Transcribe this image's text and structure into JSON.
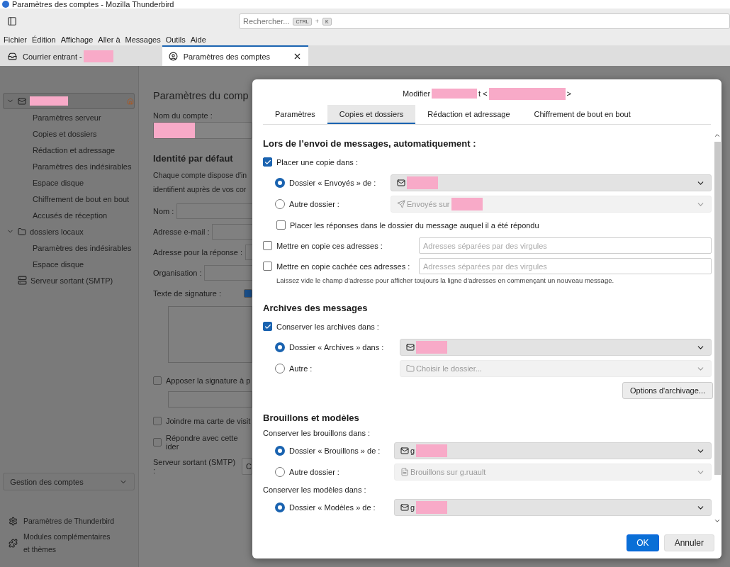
{
  "window": {
    "title": "Paramètres des comptes - Mozilla Thunderbird"
  },
  "toolbar": {
    "search_placeholder": "Rechercher...",
    "shortcut_keys": [
      "CTRL",
      "K"
    ],
    "shortcut_joiner": "+"
  },
  "menu": [
    "Fichier",
    "Édition",
    "Affichage",
    "Aller à",
    "Messages",
    "Outils",
    "Aide"
  ],
  "tabs": [
    {
      "label": "Courrier entrant -",
      "kind": "mail",
      "redacted": true,
      "closable": false,
      "selected": false
    },
    {
      "label": "Paramètres des comptes",
      "kind": "account",
      "redacted": false,
      "closable": true,
      "selected": true
    }
  ],
  "sidebar": {
    "tree": [
      {
        "kind": "account",
        "redacted": true,
        "expanded": true,
        "selected": true,
        "children": [
          {
            "label": "Paramètres serveur",
            "selected": false
          },
          {
            "label": "Copies et dossiers",
            "selected": false
          },
          {
            "label": "Rédaction et adressage",
            "selected": false
          },
          {
            "label": "Paramètres des indésirables",
            "selected": false
          },
          {
            "label": "Espace disque",
            "selected": false
          },
          {
            "label": "Chiffrement de bout en bout",
            "selected": false
          },
          {
            "label": "Accusés de réception",
            "selected": false
          }
        ]
      },
      {
        "kind": "folder",
        "label": "dossiers locaux",
        "redacted": false,
        "expanded": true,
        "selected": false,
        "children": [
          {
            "label": "Paramètres des indésirables",
            "selected": false
          },
          {
            "label": "Espace disque",
            "selected": false
          }
        ]
      },
      {
        "kind": "server",
        "label": "Serveur sortant (SMTP)",
        "redacted": false,
        "selected": false
      }
    ],
    "manage_button": "Gestion des comptes",
    "links": [
      {
        "kind": "settings",
        "label": "Paramètres de Thunderbird"
      },
      {
        "kind": "addons",
        "label": "Modules complémentaires et thèmes"
      }
    ]
  },
  "account_page": {
    "heading": "Paramètres du comp",
    "account_name_label": "Nom du compte :",
    "identity_heading": "Identité par défaut",
    "description": [
      "Chaque compte dispose d'in",
      "identifient auprès de vos cor"
    ],
    "fields": [
      "Nom :",
      "Adresse e-mail :",
      "Adresse pour la réponse :",
      "Organisation :"
    ],
    "signature_label": "Texte de signature :",
    "signature_checkbox": {
      "checked": true
    },
    "checkboxes": [
      {
        "label": "Apposer la signature à p",
        "checked": false
      },
      {
        "label": "Joindre ma carte de visit",
        "checked": false
      },
      {
        "label": "Répondre avec cette ider",
        "checked": false
      }
    ],
    "smtp_label": "Serveur sortant (SMTP) :",
    "smtp_value": "C"
  },
  "dialog": {
    "title": [
      "Modifier",
      "t <",
      ">"
    ],
    "tabs": [
      {
        "label": "Paramètres",
        "selected": false
      },
      {
        "label": "Copies et dossiers",
        "selected": true
      },
      {
        "label": "Rédaction et adressage",
        "selected": false
      },
      {
        "label": "Chiffrement de bout en bout",
        "selected": false
      }
    ],
    "sections": [
      {
        "kind": "sent",
        "heading": "Lors de l’envoi de messages, automatiquement :",
        "checkbox": {
          "label": "Placer une copie dans :",
          "checked": true
        },
        "groups": [
          {
            "options": [
              {
                "label": "Dossier « Envoyés » de :",
                "selected": true,
                "select": {
                  "redacted": true,
                  "disabled": false
                }
              },
              {
                "label": "Autre dossier :",
                "selected": false,
                "select": {
                  "value": "Envoyés sur",
                  "redacted": true,
                  "disabled": true
                }
              }
            ]
          }
        ],
        "extra_checkbox": {
          "label": "Placer les réponses dans le dossier du message auquel il a été répondu",
          "checked": false
        },
        "cc_rows": [
          {
            "label": "Mettre en copie ces adresses :",
            "checked": false,
            "placeholder": "Adresses séparées par des virgules"
          },
          {
            "label": "Mettre en copie cachée ces adresses :",
            "checked": false,
            "placeholder": "Adresses séparées par des virgules"
          }
        ],
        "hint": "Laissez vide le champ d'adresse pour afficher toujours la ligne d'adresses en commençant un nouveau message."
      },
      {
        "kind": "archives",
        "heading": "Archives des messages",
        "checkbox": {
          "label": "Conserver les archives dans :",
          "checked": true
        },
        "groups": [
          {
            "options": [
              {
                "label": "Dossier « Archives » dans :",
                "selected": true,
                "select": {
                  "redacted": true,
                  "disabled": false
                }
              },
              {
                "label": "Autre :",
                "selected": false,
                "select": {
                  "value": "Choisir le dossier...",
                  "redacted": false,
                  "disabled": true
                }
              }
            ]
          }
        ],
        "button": "Options d'archivage..."
      },
      {
        "kind": "drafts",
        "heading": "Brouillons et modèles",
        "groups": [
          {
            "sublabel": "Conserver les brouillons dans :",
            "options": [
              {
                "label": "Dossier « Brouillons » de :",
                "selected": true,
                "select": {
                  "value": "g",
                  "redacted": true,
                  "disabled": false
                }
              },
              {
                "label": "Autre dossier :",
                "selected": false,
                "select": {
                  "value": "Brouillons sur g.ruault",
                  "redacted": false,
                  "disabled": true
                }
              }
            ]
          },
          {
            "sublabel": "Conserver les modèles dans :",
            "options": [
              {
                "label": "Dossier « Modèles » de :",
                "selected": true,
                "select": {
                  "value": "g",
                  "redacted": true,
                  "disabled": false
                }
              }
            ]
          }
        ]
      }
    ],
    "buttons": [
      {
        "label": "OK",
        "kind": "primary"
      },
      {
        "label": "Annuler",
        "kind": "secondary"
      }
    ]
  }
}
